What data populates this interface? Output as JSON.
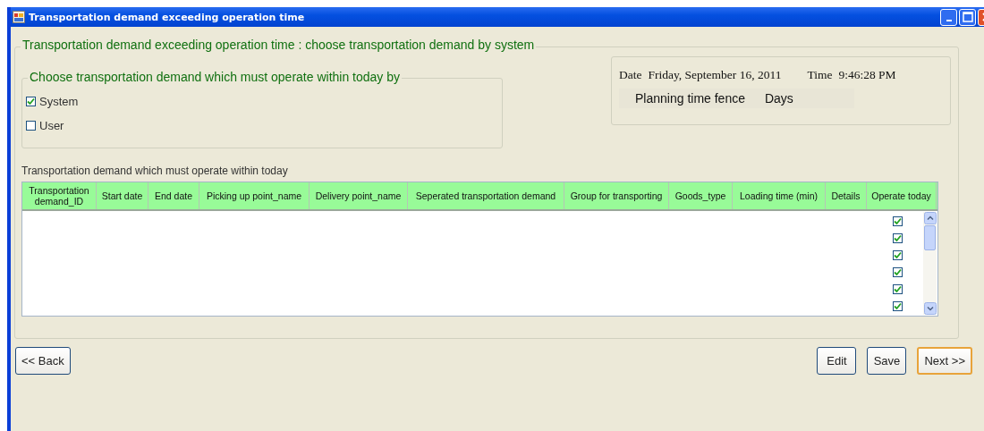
{
  "window": {
    "title": "Transportation demand exceeding operation time"
  },
  "main_group": {
    "title": "Transportation demand exceeding operation time : choose transportation demand by system"
  },
  "choose_group": {
    "title": "Choose transportation demand which must operate within today by",
    "options": [
      {
        "label": "System",
        "checked": true
      },
      {
        "label": "User",
        "checked": false
      }
    ]
  },
  "info_panel": {
    "date_label": "Date",
    "date_value": "Friday, September 16, 2011",
    "time_label": "Time",
    "time_value": "9:46:28 PM",
    "fence_label": "Planning time fence",
    "fence_unit": "Days"
  },
  "table": {
    "caption": "Transportation demand which must operate within today",
    "columns": [
      "Transportation demand_ID",
      "Start date",
      "End date",
      "Picking up point_name",
      "Delivery point_name",
      "Seperated transportation demand",
      "Group for transporting",
      "Goods_type",
      "Loading time (min)",
      "Details",
      "Operate today"
    ],
    "rows": [
      {
        "operate_today": true
      },
      {
        "operate_today": true
      },
      {
        "operate_today": true
      },
      {
        "operate_today": true
      },
      {
        "operate_today": true
      },
      {
        "operate_today": true
      }
    ]
  },
  "buttons": [
    {
      "label": "<< Back",
      "kind": "left",
      "focused": false
    },
    {
      "label": "Edit",
      "kind": "right",
      "focused": false
    },
    {
      "label": "Save",
      "kind": "right",
      "focused": false
    },
    {
      "label": "Next >>",
      "kind": "right",
      "focused": true
    }
  ]
}
